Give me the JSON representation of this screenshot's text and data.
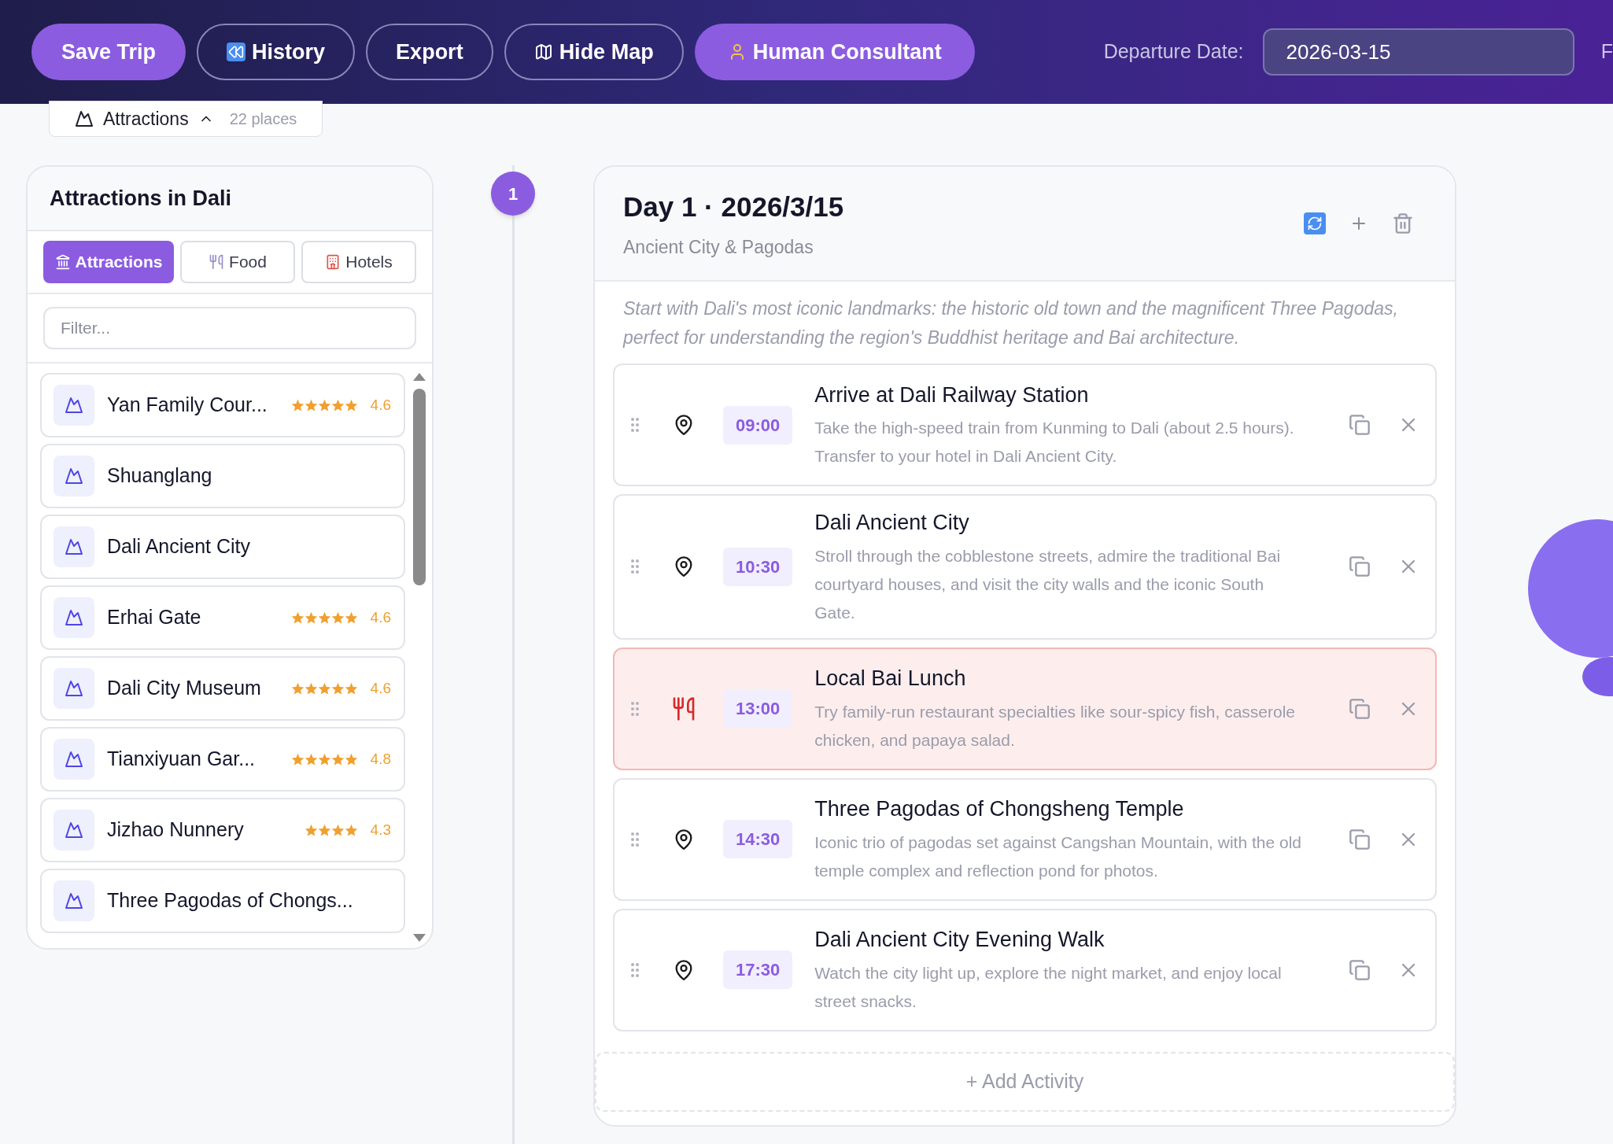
{
  "toolbar": {
    "buttons": [
      {
        "label": "Save Trip",
        "kind": "primary"
      },
      {
        "label": "History",
        "kind": "history"
      },
      {
        "label": "Export",
        "kind": "plain"
      },
      {
        "label": "Hide Map",
        "kind": "map"
      },
      {
        "label": "Human Consultant",
        "kind": "consultant"
      }
    ],
    "departure_label": "Departure Date:",
    "departure_value": "2026-03-15",
    "cut_label": "F"
  },
  "category_toggle": {
    "label": "Attractions",
    "count": "22 places",
    "expanded": true
  },
  "panel": {
    "title": "Attractions in Dali",
    "tabs": [
      {
        "label": "Attractions",
        "kind": "attractions",
        "selected": true
      },
      {
        "label": "Food",
        "kind": "food",
        "selected": false
      },
      {
        "label": "Hotels",
        "kind": "hotels",
        "selected": false
      }
    ],
    "filter": {
      "placeholder": "Filter..."
    },
    "places": [
      {
        "name": "Yan Family Cour...",
        "stars": 5,
        "rating": "4.6"
      },
      {
        "name": "Shuanglang"
      },
      {
        "name": "Dali Ancient City"
      },
      {
        "name": "Erhai Gate",
        "stars": 5,
        "rating": "4.6"
      },
      {
        "name": "Dali City Museum",
        "stars": 5,
        "rating": "4.6"
      },
      {
        "name": "Tianxiyuan Gar...",
        "stars": 5,
        "rating": "4.8"
      },
      {
        "name": "Jizhao Nunnery",
        "stars": 4,
        "rating": "4.3"
      },
      {
        "name": "Three Pagodas of Chongs..."
      }
    ]
  },
  "day": {
    "number": "1",
    "title": "Day 1 · 2026/3/15",
    "subtitle": "Ancient City & Pagodas",
    "description": "Start with Dali's most iconic landmarks: the historic old town and the magnificent Three Pagodas, perfect for understanding the region's Buddhist heritage and Bai architecture.",
    "activities": [
      {
        "kind": "place",
        "time": "09:00",
        "title": "Arrive at Dali Railway Station",
        "text": "Take the high-speed train from Kunming to Dali (about 2.5 hours). Transfer to your hotel in Dali Ancient City."
      },
      {
        "kind": "place",
        "time": "10:30",
        "title": "Dali Ancient City",
        "text": "Stroll through the cobblestone streets, admire the traditional Bai courtyard houses, and visit the city walls and the iconic South Gate."
      },
      {
        "kind": "food",
        "time": "13:00",
        "title": "Local Bai Lunch",
        "text": "Try family-run restaurant specialties like sour-spicy fish, casserole chicken, and papaya salad."
      },
      {
        "kind": "place",
        "time": "14:30",
        "title": "Three Pagodas of Chongsheng Temple",
        "text": "Iconic trio of pagodas set against Cangshan Mountain, with the old temple complex and reflection pond for photos."
      },
      {
        "kind": "place",
        "time": "17:30",
        "title": "Dali Ancient City Evening Walk",
        "text": "Watch the city light up, explore the night market, and enjoy local street snacks."
      }
    ],
    "add_label": "+ Add Activity"
  }
}
